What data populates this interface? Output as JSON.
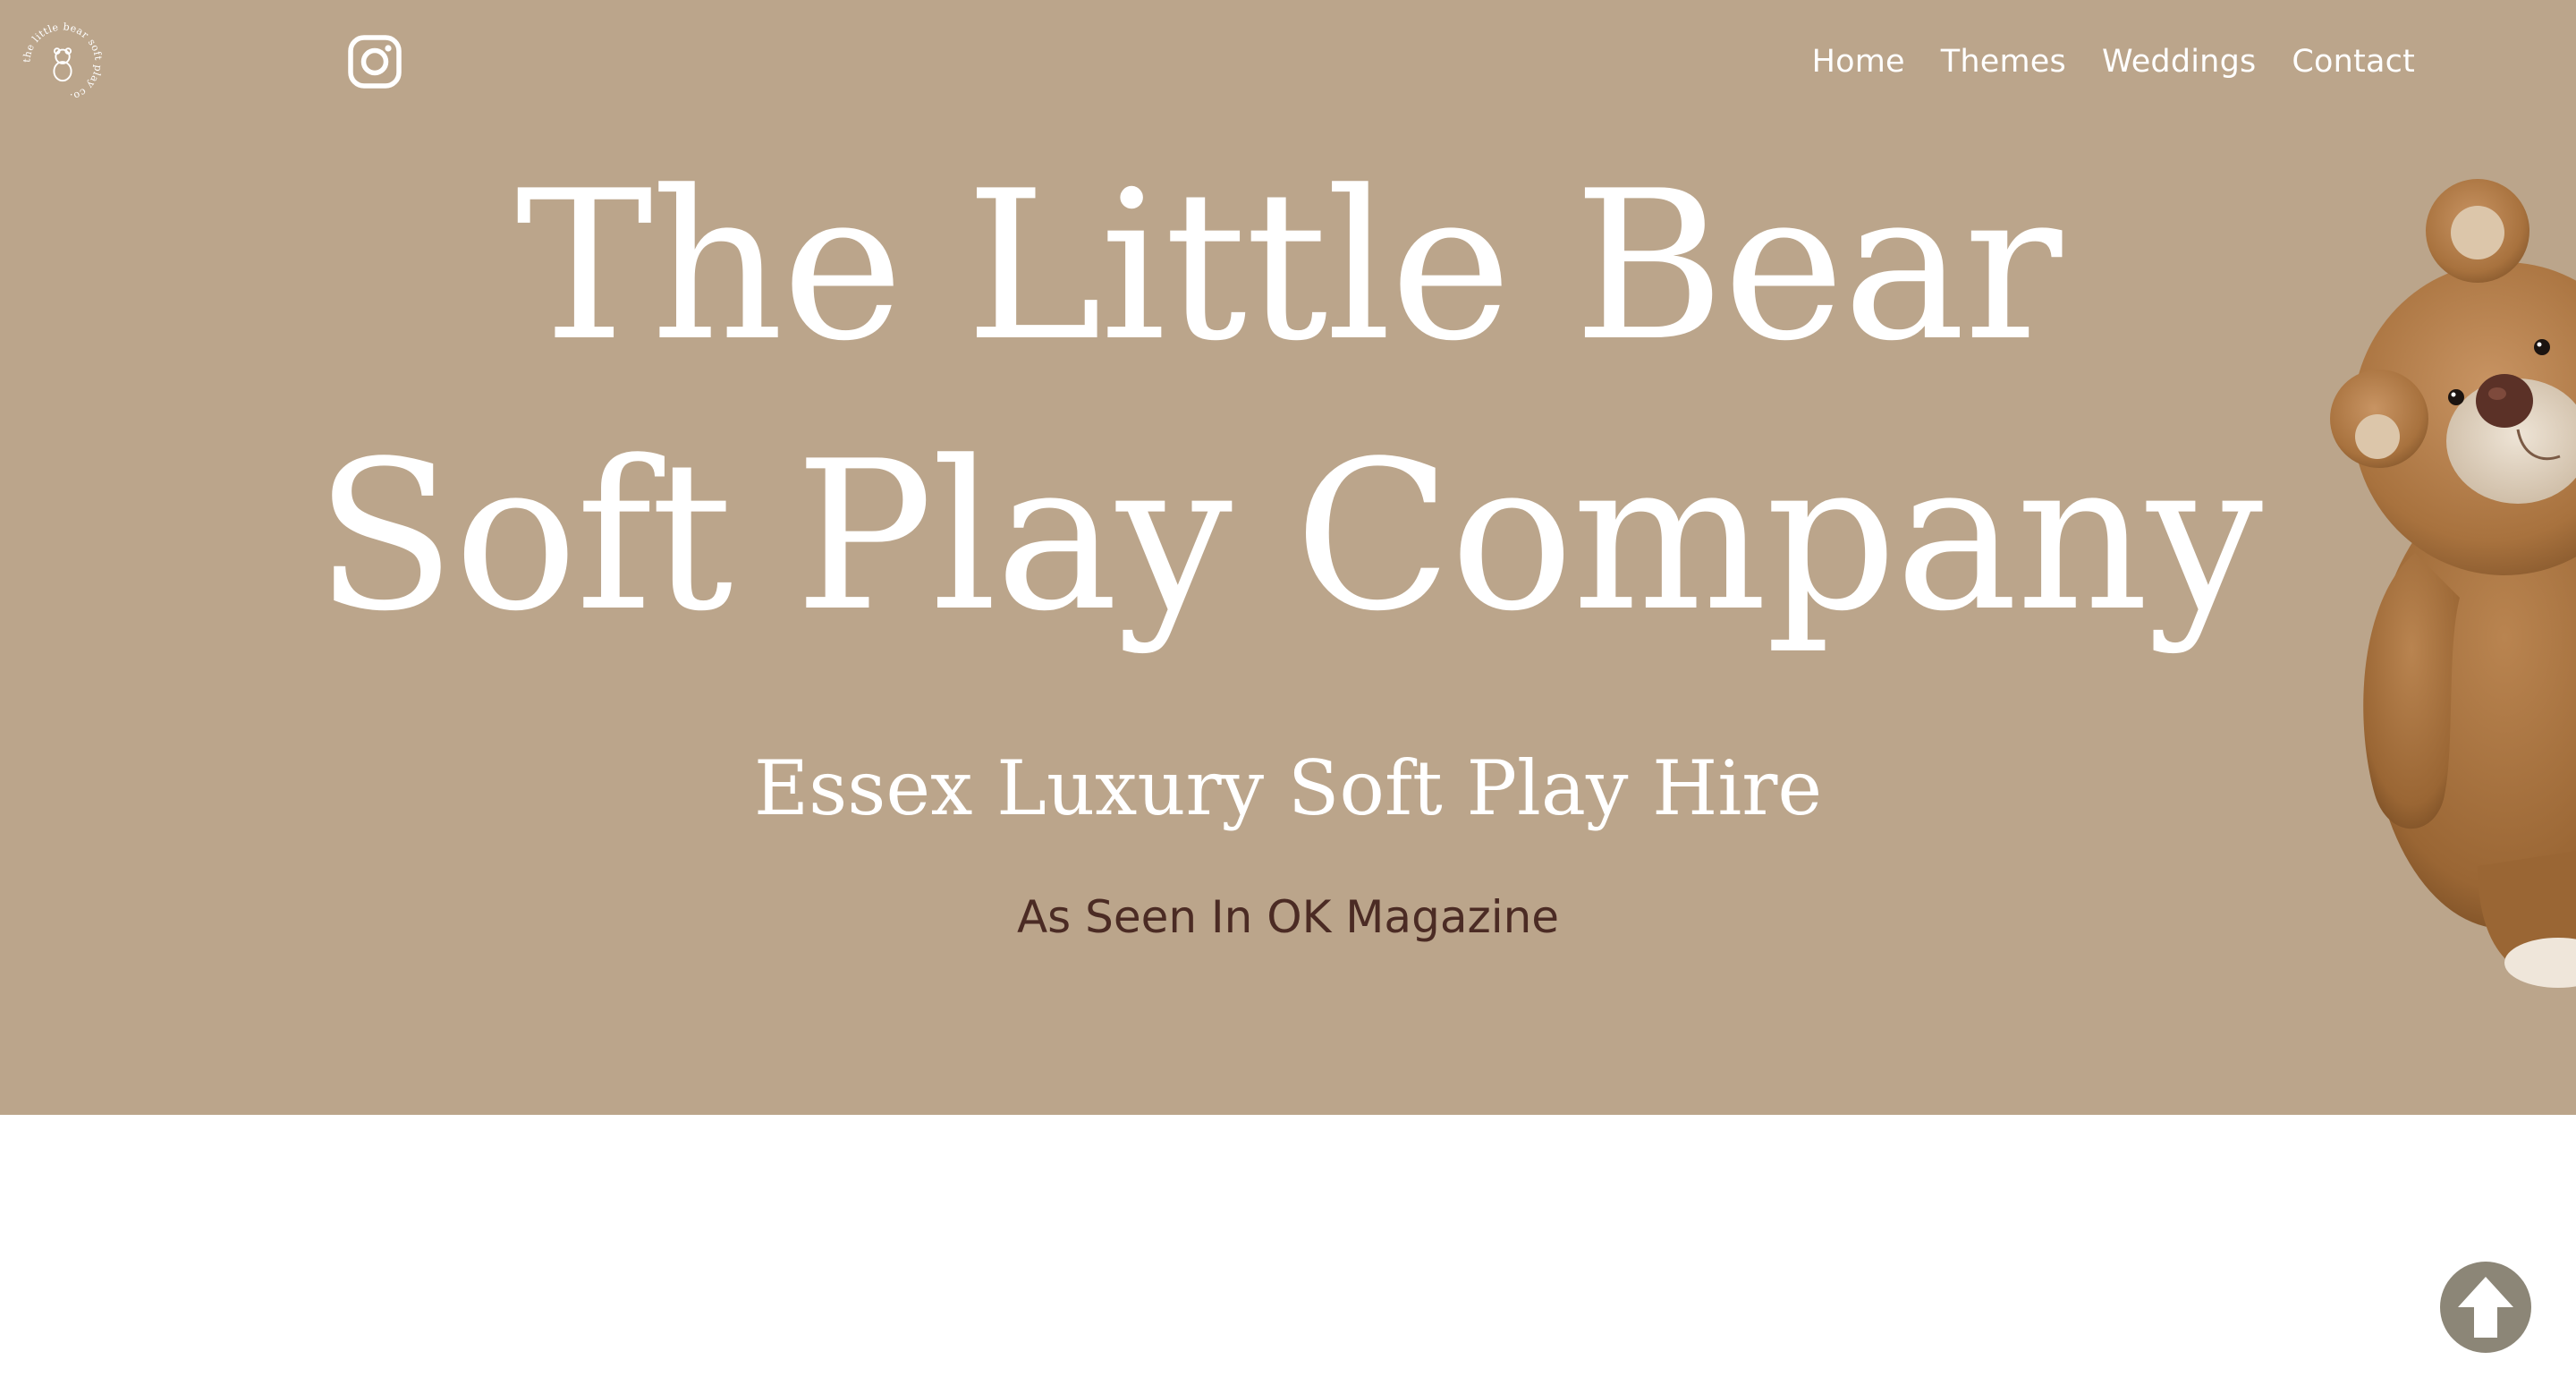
{
  "brand": {
    "logo_text": "the little bear soft play co."
  },
  "header": {
    "instagram_icon": "instagram-icon",
    "nav": [
      {
        "label": "Home"
      },
      {
        "label": "Themes"
      },
      {
        "label": "Weddings"
      },
      {
        "label": "Contact"
      }
    ]
  },
  "hero": {
    "title_line1": "The Little Bear",
    "title_line2": "Soft Play Company",
    "subtitle": "Essex Luxury Soft Play Hire",
    "tagline": "As Seen In OK Magazine",
    "image_icon": "teddy-bear-image"
  },
  "scroll_top": {
    "icon": "arrow-up-icon"
  },
  "colors": {
    "hero_background": "#bba58b",
    "tagline_text": "#4b2b24",
    "scroll_button": "#8c8677",
    "page_background": "#ffffff"
  }
}
